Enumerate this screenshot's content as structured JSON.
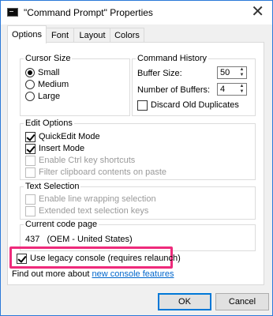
{
  "window": {
    "title": "\"Command Prompt\" Properties",
    "close_glyph": "✕"
  },
  "tabs": [
    {
      "label": "Options",
      "active": true
    },
    {
      "label": "Font",
      "active": false
    },
    {
      "label": "Layout",
      "active": false
    },
    {
      "label": "Colors",
      "active": false
    }
  ],
  "cursor_size": {
    "label": "Cursor Size",
    "options": [
      {
        "label": "Small",
        "selected": true
      },
      {
        "label": "Medium",
        "selected": false
      },
      {
        "label": "Large",
        "selected": false
      }
    ]
  },
  "command_history": {
    "label": "Command History",
    "buffer_size_label": "Buffer Size:",
    "buffer_size_value": "50",
    "num_buffers_label": "Number of Buffers:",
    "num_buffers_value": "4",
    "discard_label": "Discard Old Duplicates",
    "discard_checked": false
  },
  "edit_options": {
    "label": "Edit Options",
    "items": [
      {
        "label": "QuickEdit Mode",
        "checked": true,
        "enabled": true
      },
      {
        "label": "Insert Mode",
        "checked": true,
        "enabled": true
      },
      {
        "label": "Enable Ctrl key shortcuts",
        "checked": false,
        "enabled": false
      },
      {
        "label": "Filter clipboard contents on paste",
        "checked": false,
        "enabled": false
      }
    ]
  },
  "text_selection": {
    "label": "Text Selection",
    "items": [
      {
        "label": "Enable line wrapping selection",
        "checked": false,
        "enabled": false
      },
      {
        "label": "Extended text selection keys",
        "checked": false,
        "enabled": false
      }
    ]
  },
  "code_page": {
    "label": "Current code page",
    "value": "437   (OEM - United States)"
  },
  "legacy": {
    "label": "Use legacy console (requires relaunch)",
    "checked": true,
    "highlight_color": "#ee2a7b"
  },
  "find_more": {
    "text": "Find out more about",
    "link": "new console features"
  },
  "buttons": {
    "ok": "OK",
    "cancel": "Cancel"
  },
  "colors": {
    "accent": "#0078d7",
    "link": "#0066cc"
  }
}
